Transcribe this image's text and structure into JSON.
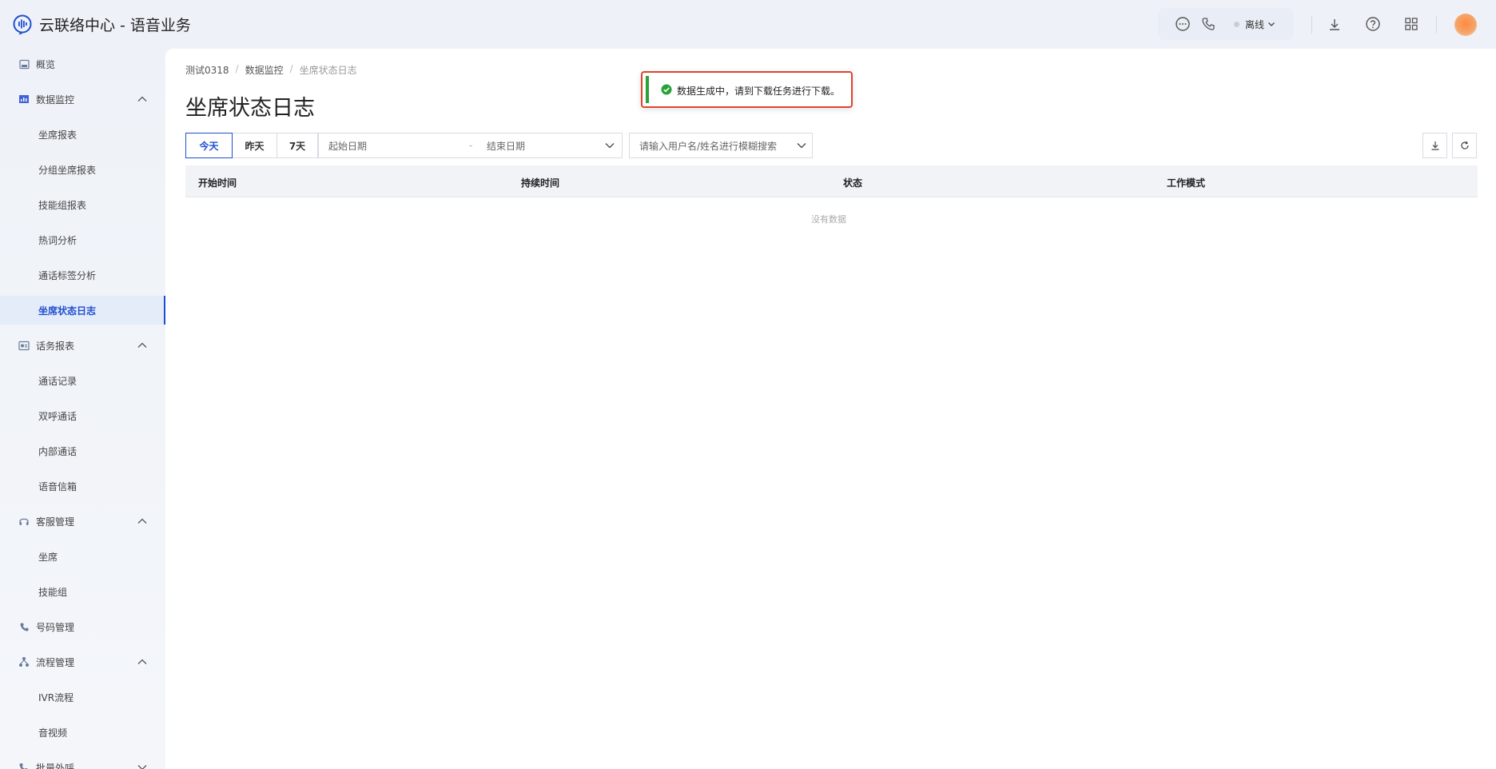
{
  "header": {
    "title": "云联络中心 - 语音业务",
    "status_label": "离线"
  },
  "sidebar": {
    "items": [
      {
        "label": "概览",
        "level": "top",
        "icon": "overview-icon"
      },
      {
        "label": "数据监控",
        "level": "top",
        "icon": "monitor-icon",
        "expanded": true
      },
      {
        "label": "坐席报表",
        "level": "sub"
      },
      {
        "label": "分组坐席报表",
        "level": "sub"
      },
      {
        "label": "技能组报表",
        "level": "sub"
      },
      {
        "label": "热词分析",
        "level": "sub"
      },
      {
        "label": "通话标签分析",
        "level": "sub"
      },
      {
        "label": "坐席状态日志",
        "level": "sub",
        "active": true
      },
      {
        "label": "话务报表",
        "level": "top",
        "icon": "report-icon",
        "expanded": true
      },
      {
        "label": "通话记录",
        "level": "sub"
      },
      {
        "label": "双呼通话",
        "level": "sub"
      },
      {
        "label": "内部通话",
        "level": "sub"
      },
      {
        "label": "语音信箱",
        "level": "sub"
      },
      {
        "label": "客服管理",
        "level": "top",
        "icon": "headset-icon",
        "expanded": true
      },
      {
        "label": "坐席",
        "level": "sub"
      },
      {
        "label": "技能组",
        "level": "sub"
      },
      {
        "label": "号码管理",
        "level": "top",
        "icon": "phone-icon"
      },
      {
        "label": "流程管理",
        "level": "top",
        "icon": "flow-icon",
        "expanded": true
      },
      {
        "label": "IVR流程",
        "level": "sub"
      },
      {
        "label": "音视频",
        "level": "sub"
      },
      {
        "label": "批量外呼",
        "level": "top",
        "icon": "batch-call-icon",
        "expanded": false
      }
    ]
  },
  "breadcrumb": [
    "测试0318",
    "数据监控",
    "坐席状态日志"
  ],
  "page_title": "坐席状态日志",
  "filters": {
    "quick_range": [
      "今天",
      "昨天",
      "7天"
    ],
    "active_range": "今天",
    "start_placeholder": "起始日期",
    "range_separator": "-",
    "end_placeholder": "结束日期",
    "user_search_placeholder": "请输入用户名/姓名进行模糊搜索"
  },
  "table": {
    "columns": [
      "开始时间",
      "持续时间",
      "状态",
      "工作模式"
    ],
    "rows": [],
    "empty_text": "没有数据"
  },
  "toast": {
    "message": "数据生成中，请到下载任务进行下载。",
    "type": "success"
  },
  "colors": {
    "accent": "#1f4fd0",
    "success": "#2aa23a",
    "highlight_border": "#e0442a"
  }
}
